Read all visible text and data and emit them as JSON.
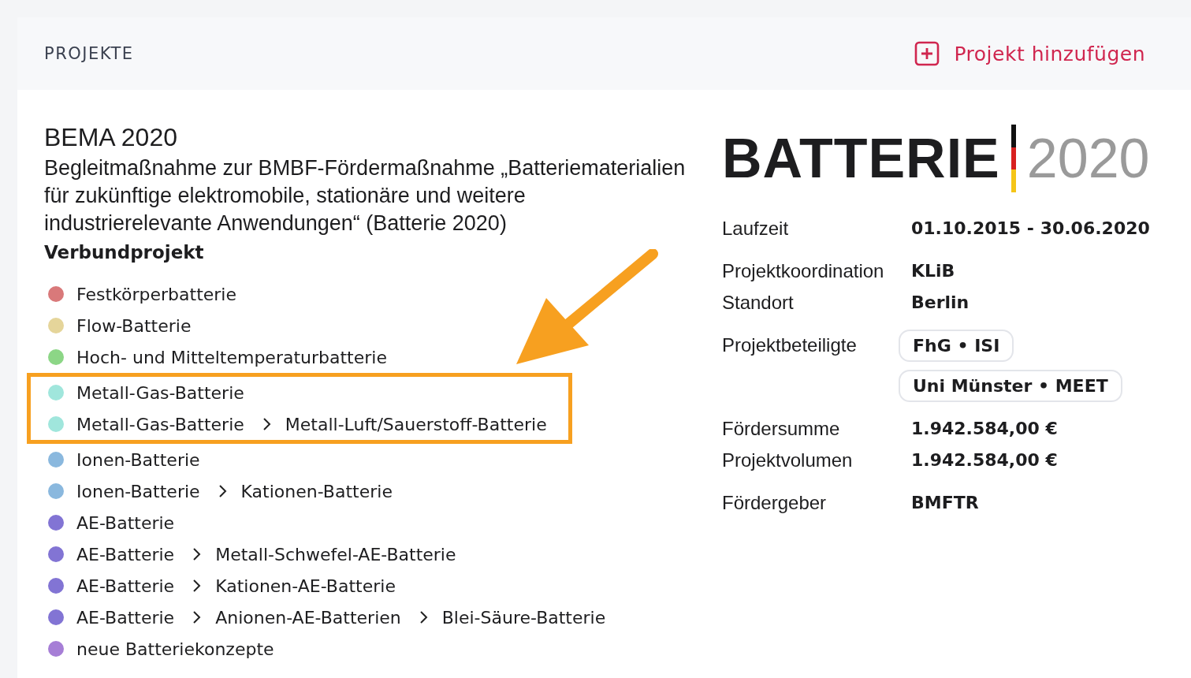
{
  "header": {
    "title": "PROJEKTE",
    "action": "Projekt hinzufügen"
  },
  "project": {
    "title": "BEMA 2020",
    "description": "Begleitmaßnahme zur BMBF-Fördermaßnahme „Batteriematerialien für zukünftige elektromobile, stationäre und weitere industrierelevante Anwendungen“ (Batterie 2020)",
    "type": "Verbundprojekt"
  },
  "categories": [
    {
      "path": [
        "Festkörperbatterie"
      ],
      "color": "#d9797a",
      "highlighted": false
    },
    {
      "path": [
        "Flow-Batterie"
      ],
      "color": "#e5d59a",
      "highlighted": false
    },
    {
      "path": [
        "Hoch- und Mitteltemperaturbatterie"
      ],
      "color": "#8cd686",
      "highlighted": false
    },
    {
      "path": [
        "Metall-Gas-Batterie"
      ],
      "color": "#a0e6dc",
      "highlighted": true
    },
    {
      "path": [
        "Metall-Gas-Batterie",
        "Metall-Luft/Sauerstoff-Batterie"
      ],
      "color": "#a0e6dc",
      "highlighted": true
    },
    {
      "path": [
        "Ionen-Batterie"
      ],
      "color": "#8ab8de",
      "highlighted": false
    },
    {
      "path": [
        "Ionen-Batterie",
        "Kationen-Batterie"
      ],
      "color": "#8ab8de",
      "highlighted": false
    },
    {
      "path": [
        "AE-Batterie"
      ],
      "color": "#8274d4",
      "highlighted": false
    },
    {
      "path": [
        "AE-Batterie",
        "Metall-Schwefel-AE-Batterie"
      ],
      "color": "#8274d4",
      "highlighted": false
    },
    {
      "path": [
        "AE-Batterie",
        "Kationen-AE-Batterie"
      ],
      "color": "#8274d4",
      "highlighted": false
    },
    {
      "path": [
        "AE-Batterie",
        "Anionen-AE-Batterien",
        "Blei-Säure-Batterie"
      ],
      "color": "#8274d4",
      "highlighted": false
    },
    {
      "path": [
        "neue Batteriekonzepte"
      ],
      "color": "#a67ed6",
      "highlighted": false
    }
  ],
  "logo": {
    "word": "BATTERIE",
    "year": "2020"
  },
  "details": [
    [
      {
        "label": "Laufzeit",
        "kind": "text",
        "value": "01.10.2015 - 30.06.2020"
      }
    ],
    [
      {
        "label": "Projektkoordination",
        "kind": "text",
        "value": "KLiB"
      },
      {
        "label": "Standort",
        "kind": "text",
        "value": "Berlin"
      }
    ],
    [
      {
        "label": "Projektbeteiligte",
        "kind": "tags",
        "tags": [
          "FhG • ISI",
          "Uni Münster • MEET"
        ]
      }
    ],
    [
      {
        "label": "Fördersumme",
        "kind": "text",
        "value": "1.942.584,00 €"
      },
      {
        "label": "Projektvolumen",
        "kind": "text",
        "value": "1.942.584,00 €"
      }
    ],
    [
      {
        "label": "Fördergeber",
        "kind": "text",
        "value": "BMFTR"
      }
    ]
  ]
}
